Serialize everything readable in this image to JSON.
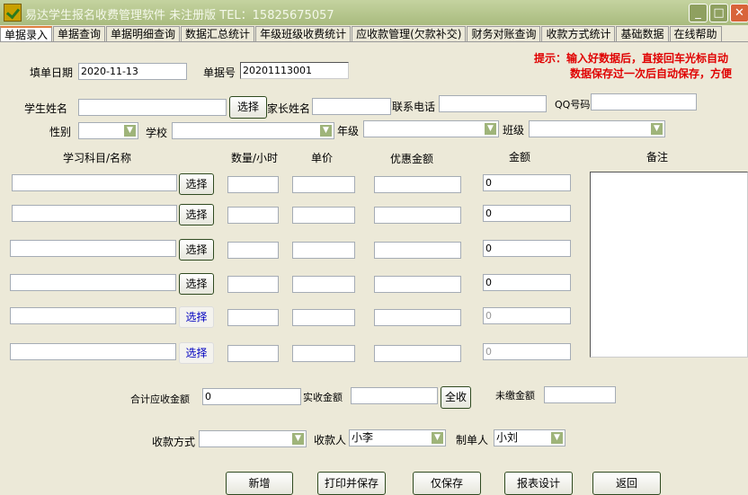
{
  "window": {
    "title": "易达学生报名收费管理软件 未注册版  TEL：15825675057",
    "minimize": "_",
    "maximize": "□",
    "close": "✕"
  },
  "tabs": [
    "单据录入",
    "单据查询",
    "单据明细查询",
    "数据汇总统计",
    "年级班级收费统计",
    "应收款管理(欠款补交)",
    "财务对账查询",
    "收款方式统计",
    "基础数据",
    "在线帮助"
  ],
  "hint": {
    "line1": "提示：输入好数据后，直接回车光标自动",
    "line2": "数据保存过一次后自动保存，方便"
  },
  "form": {
    "date_label": "填单日期",
    "date_value": "2020-11-13",
    "bill_label": "单据号",
    "bill_value": "20201113001",
    "student_label": "学生姓名",
    "select_label": "选择",
    "parent_label": "家长姓名",
    "phone_label": "联系电话",
    "qq_label": "QQ号码",
    "gender_label": "性别",
    "school_label": "学校",
    "grade_label": "年级",
    "class_label": "班级"
  },
  "columns": {
    "subject": "学习科目/名称",
    "qty": "数量/小时",
    "price": "单价",
    "discount": "优惠金额",
    "amount": "金额",
    "remark": "备注"
  },
  "rows": [
    {
      "amount": "0",
      "select": "选择"
    },
    {
      "amount": "0",
      "select": "选择"
    },
    {
      "amount": "0",
      "select": "选择"
    },
    {
      "amount": "0",
      "select": "选择"
    },
    {
      "amount": "0",
      "select": "选择"
    },
    {
      "amount": "0",
      "select": "选择"
    }
  ],
  "totals": {
    "due_label": "合计应收金额",
    "due_value": "0",
    "paid_label": "实收金额",
    "all_label": "全收",
    "unpaid_label": "未缴金额"
  },
  "payment": {
    "method_label": "收款方式",
    "payee_label": "收款人",
    "payee_value": "小李",
    "maker_label": "制单人",
    "maker_value": "小刘"
  },
  "actions": {
    "new": "新增",
    "print_save": "打印并保存",
    "save": "仅保存",
    "report": "报表设计",
    "back": "返回"
  }
}
